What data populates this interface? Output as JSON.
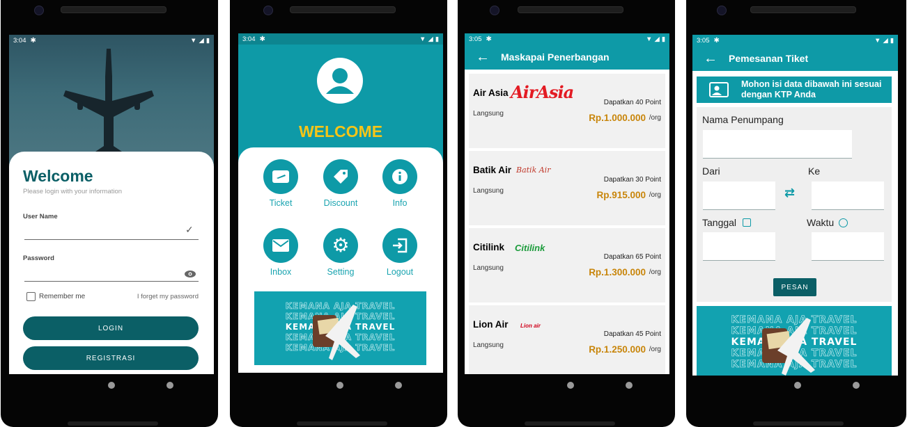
{
  "screen1": {
    "status_time": "3:04",
    "title": "Welcome",
    "subtitle": "Please login with your information",
    "username_label": "User Name",
    "password_label": "Password",
    "remember_label": "Remember me",
    "forgot_label": "I forget my password",
    "login_button": "LOGIN",
    "register_button": "REGISTRASI"
  },
  "screen2": {
    "status_time": "3:04",
    "welcome": "WELCOME",
    "tiles": [
      {
        "label": "Ticket",
        "icon": "ticket-icon"
      },
      {
        "label": "Discount",
        "icon": "tag-icon"
      },
      {
        "label": "Info",
        "icon": "info-icon"
      },
      {
        "label": "Inbox",
        "icon": "mail-icon"
      },
      {
        "label": "Setting",
        "icon": "gear-icon"
      },
      {
        "label": "Logout",
        "icon": "logout-icon"
      }
    ],
    "banner_text": "KEMANA AJA TRAVEL"
  },
  "screen3": {
    "status_time": "3:05",
    "title": "Maskapai Penerbangan",
    "airlines": [
      {
        "name": "Air Asia",
        "logo": "AirAsia",
        "type": "Langsung",
        "points": "Dapatkan 40 Point",
        "price": "Rp.1.000.000",
        "unit": "/org"
      },
      {
        "name": "Batik Air",
        "logo": "Batik Air",
        "type": "Langsung",
        "points": "Dapatkan 30 Point",
        "price": "Rp.915.000",
        "unit": "/org"
      },
      {
        "name": "Citilink",
        "logo": "Citilink",
        "type": "Langsung",
        "points": "Dapatkan 65 Point",
        "price": "Rp.1.300.000",
        "unit": "/org"
      },
      {
        "name": "Lion Air",
        "logo": "Lion air",
        "type": "Langsung",
        "points": "Dapatkan 45 Point",
        "price": "Rp.1.250.000",
        "unit": "/org"
      }
    ]
  },
  "screen4": {
    "status_time": "3:05",
    "title": "Pemesanan Tiket",
    "notice": "Mohon isi data dibawah ini sesuai dengan KTP Anda",
    "name_label": "Nama Penumpang",
    "from_label": "Dari",
    "to_label": "Ke",
    "date_label": "Tanggal",
    "time_label": "Waktu",
    "submit_button": "PESAN",
    "banner_text": "KEMANA AJA TRAVEL"
  },
  "colors": {
    "teal": "#0e9aa7",
    "dark_teal": "#0b5f66",
    "price": "#c8850a",
    "welcome_yellow": "#f5c518"
  }
}
